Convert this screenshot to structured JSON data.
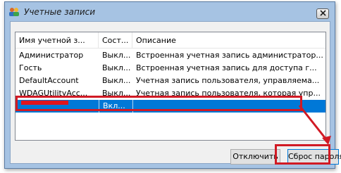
{
  "window": {
    "title": "Учетные записи"
  },
  "list": {
    "columns": [
      "Имя учетной з...",
      "Сост...",
      "Описание"
    ],
    "rows": [
      {
        "name": "Администратор",
        "state": "Выкл...",
        "description": "Встроенная учетная запись администратор..."
      },
      {
        "name": "Гость",
        "state": "Выкл...",
        "description": "Встроенная учетная запись для доступа г..."
      },
      {
        "name": "DefaultAccount",
        "state": "Выкл...",
        "description": "Учетная запись пользователя, управляема..."
      },
      {
        "name": "WDAGUtilityAcc...",
        "state": "Выкл...",
        "description": "Учетная запись пользователя, которая упр..."
      },
      {
        "name": "",
        "state": "Вкл...",
        "description": ""
      }
    ]
  },
  "buttons": {
    "disable": "Отключить",
    "reset_password": "Сброс пароля"
  },
  "colors": {
    "highlight": "#d11a24",
    "selection": "#0078d7",
    "title_bar": "#a6c3e3"
  }
}
